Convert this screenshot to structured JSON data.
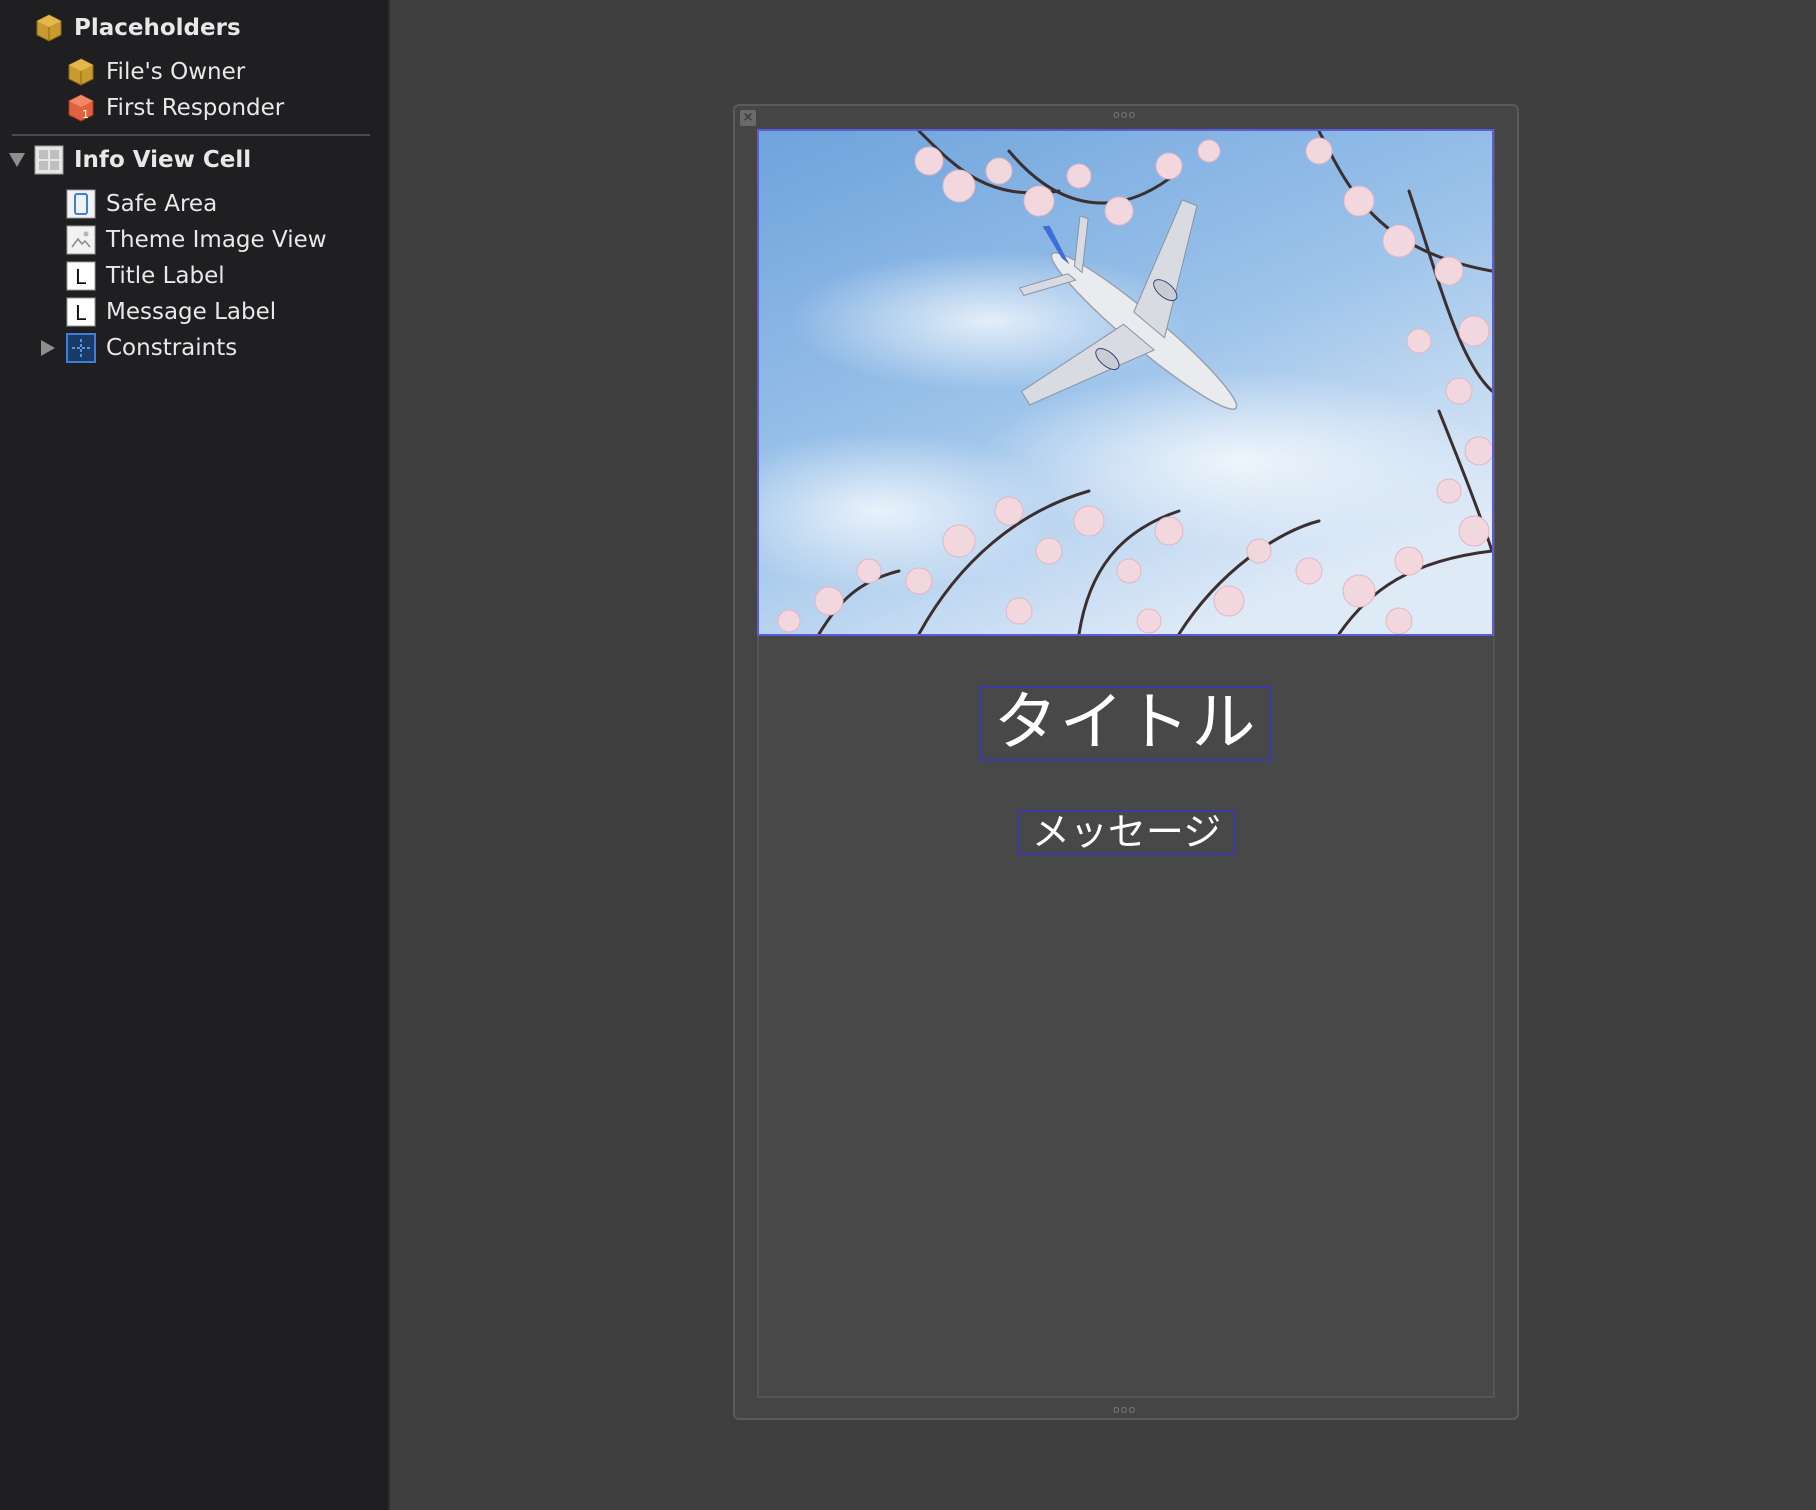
{
  "outline": {
    "placeholders": {
      "label": "Placeholders",
      "items": [
        {
          "label": "File's Owner",
          "icon": "cube-icon"
        },
        {
          "label": "First Responder",
          "icon": "first-responder-icon"
        }
      ]
    },
    "root": {
      "label": "Info View Cell",
      "expanded": true,
      "children": [
        {
          "label": "Safe Area",
          "icon": "safe-area-icon"
        },
        {
          "label": "Theme Image View",
          "icon": "image-view-icon"
        },
        {
          "label": "Title Label",
          "icon": "label-icon",
          "glyph": "L"
        },
        {
          "label": "Message Label",
          "icon": "label-icon",
          "glyph": "L"
        },
        {
          "label": "Constraints",
          "icon": "constraints-icon",
          "expanded": false
        }
      ]
    }
  },
  "canvas": {
    "title_text": "タイトル",
    "message_text": "メッセージ",
    "close_glyph": "×",
    "handle_glyph": "ooo",
    "colors": {
      "sky": "#8fb9e6",
      "sky_light": "#d9e8f7",
      "blossom": "#f3d7df",
      "branch": "#3b2f2f",
      "selection": "#5b5bdc"
    }
  }
}
